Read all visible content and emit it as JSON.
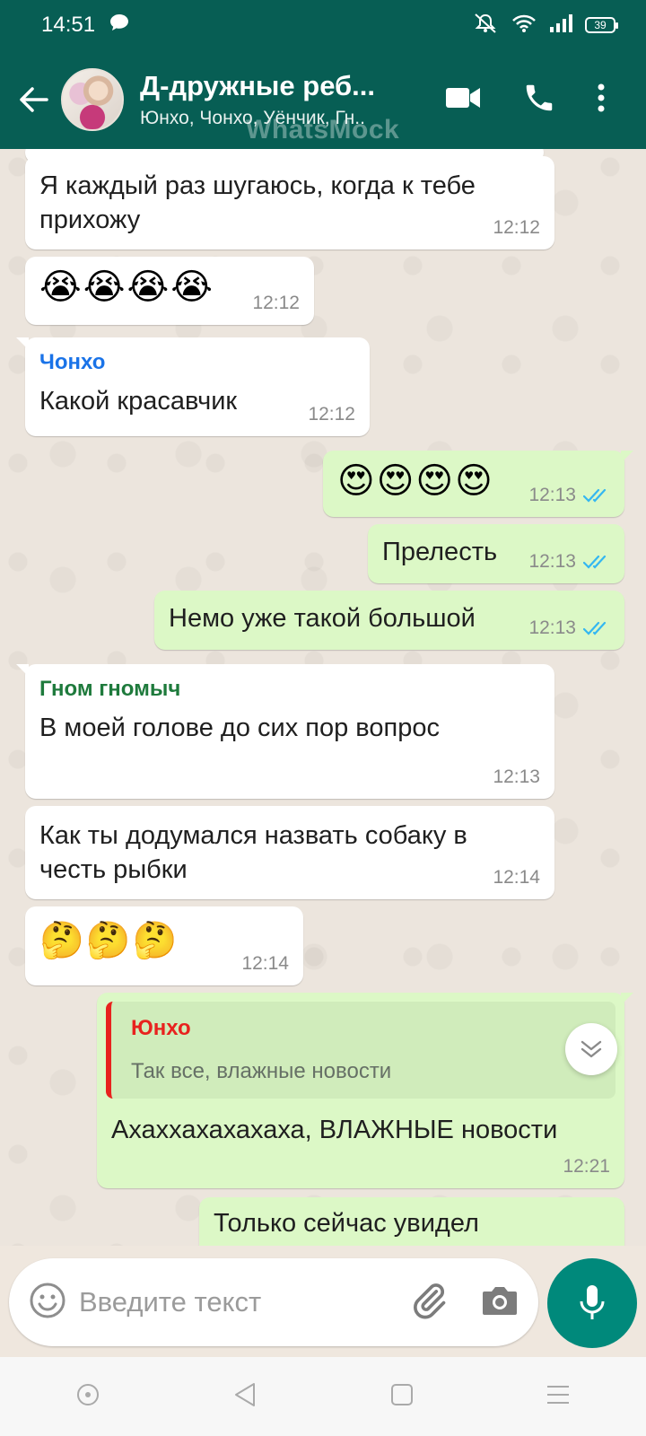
{
  "status_bar": {
    "time": "14:51",
    "battery": "39"
  },
  "header": {
    "title": "Д-дружные реб...",
    "subtitle": "Юнхо, Чонхо, Уёнчик, Гн..",
    "watermark": "WhatsMock"
  },
  "messages": [
    {
      "text": "Я каждый раз шугаюсь, когда к тебе прихожу",
      "time": "12:12"
    },
    {
      "text": "😭😭😭😭",
      "time": "12:12"
    },
    {
      "sender": "Чонхо",
      "sender_color": "#1a73e8",
      "text": "Какой красавчик",
      "time": "12:12"
    },
    {
      "text": "😍😍😍😍",
      "time": "12:13"
    },
    {
      "text": "Прелесть",
      "time": "12:13"
    },
    {
      "text": "Немо уже такой большой",
      "time": "12:13"
    },
    {
      "sender": "Гном гномыч",
      "sender_color": "#1e7a3c",
      "text": "В моей голове до сих пор вопрос",
      "time": "12:13"
    },
    {
      "text": "Как ты додумался назвать собаку в честь рыбки",
      "time": "12:14"
    },
    {
      "text": "🤔🤔🤔",
      "time": "12:14"
    },
    {
      "quote_name": "Юнхо",
      "quote_text": "Так все, влажные новости",
      "text": "Ахаххахахахаха, ВЛАЖНЫЕ новости",
      "time": "12:21"
    },
    {
      "text": "Только сейчас увидел"
    }
  ],
  "composer": {
    "placeholder": "Введите текст"
  },
  "colors": {
    "header": "#075e54",
    "outgoing": "#dcf8c6",
    "incoming": "#ffffff",
    "read_ticks": "#34b7f1",
    "fab": "#00897b"
  }
}
